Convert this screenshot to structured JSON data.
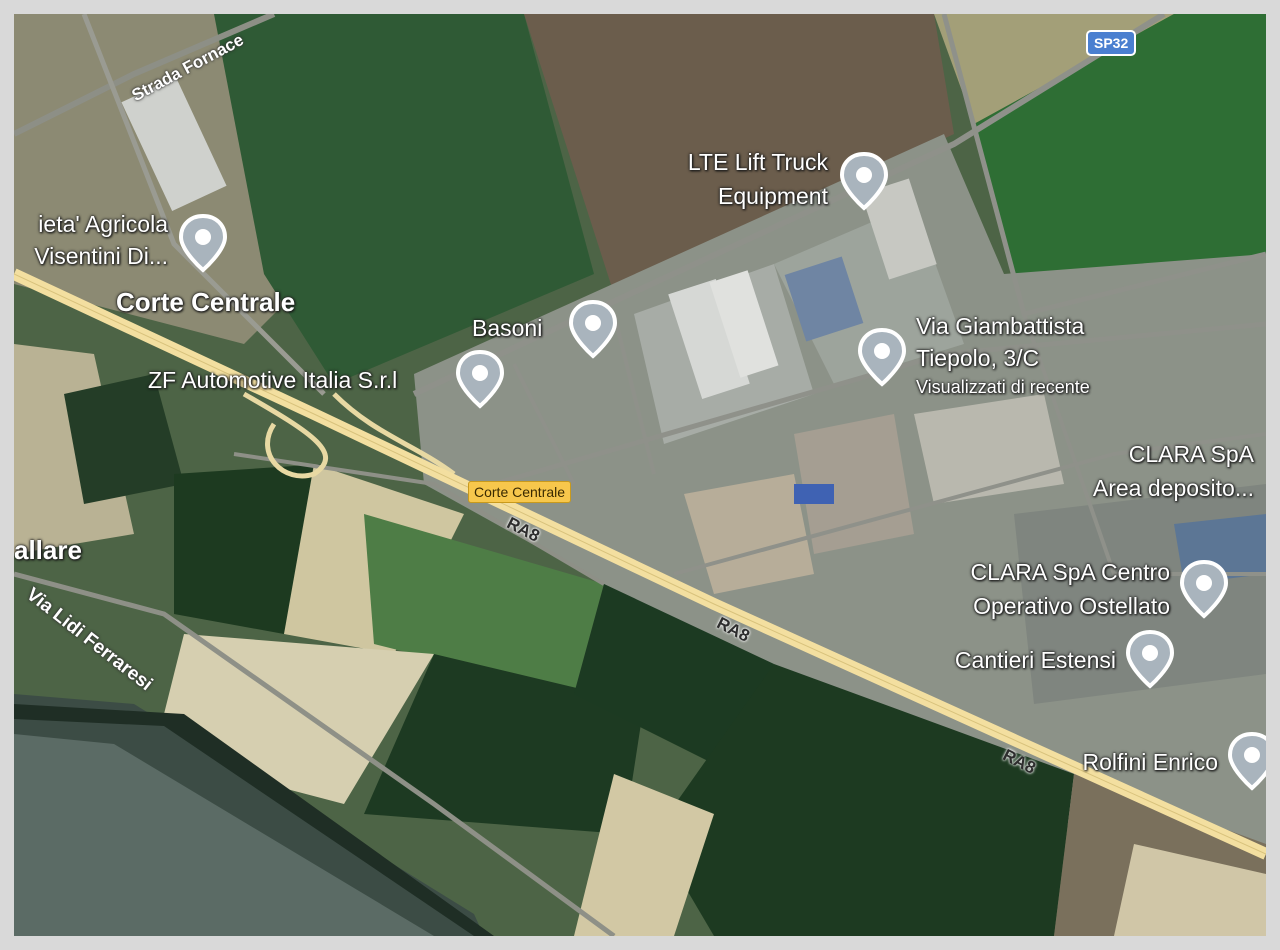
{
  "map": {
    "places": {
      "corte_centrale": "Corte Centrale",
      "ballare": "allare",
      "az_agricola_line1": "ieta' Agricola",
      "az_agricola_line2": "Visentini Di...",
      "zf": "ZF Automotive Italia S.r.l",
      "basoni": "Basoni",
      "lte_line1": "LTE Lift Truck",
      "lte_line2": "Equipment",
      "via_tiepolo_line1": "Via Giambattista",
      "via_tiepolo_line2": "Tiepolo, 3/C",
      "via_tiepolo_sub": "Visualizzati di recente",
      "clara_area_line1": "CLARA SpA",
      "clara_area_line2": "Area deposito...",
      "clara_centro_line1": "CLARA SpA Centro",
      "clara_centro_line2": "Operativo Ostellato",
      "cantieri": "Cantieri Estensi",
      "rolfini": "Rolfini Enrico"
    },
    "roads": {
      "strada_fornace": "Strada Fornace",
      "via_lidi": "Via Lidi Ferraresi",
      "ra8": "RA8",
      "highway_label": "Corte Centrale",
      "sp32": "SP32"
    },
    "pin_icon": "map-pin-icon",
    "colors": {
      "highway": "#f3dfa0",
      "pin_fill": "#a9b4bd",
      "highway_tag": "#f7c74c",
      "shield": "#4a7fd0"
    }
  }
}
